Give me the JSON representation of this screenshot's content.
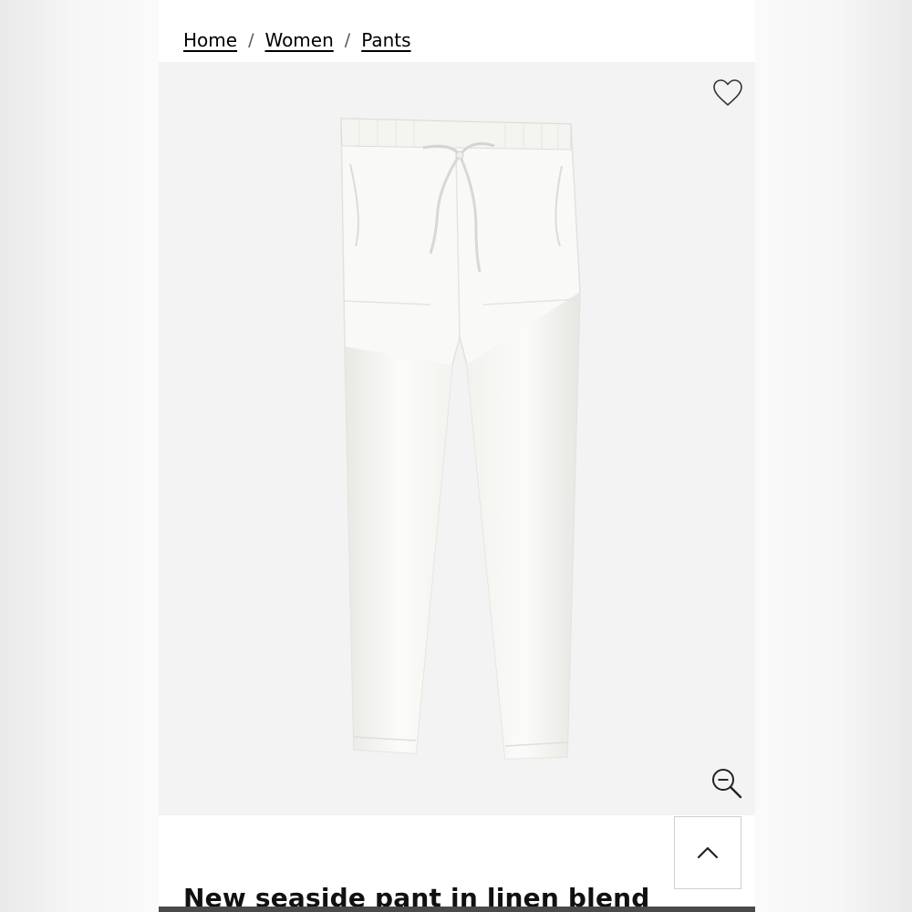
{
  "breadcrumb": {
    "items": [
      {
        "label": "Home"
      },
      {
        "label": "Women"
      },
      {
        "label": "Pants"
      }
    ],
    "separator": "/"
  },
  "product": {
    "title": "New seaside pant in linen blend",
    "image_alt": "White linen blend drawstring pants"
  },
  "icons": {
    "wishlist": "heart-icon",
    "zoom": "zoom-out-icon",
    "scroll_top": "chevron-up-icon"
  },
  "colors": {
    "page_background": "#fafafa",
    "image_background": "#f3f3f3",
    "text": "#111111"
  }
}
